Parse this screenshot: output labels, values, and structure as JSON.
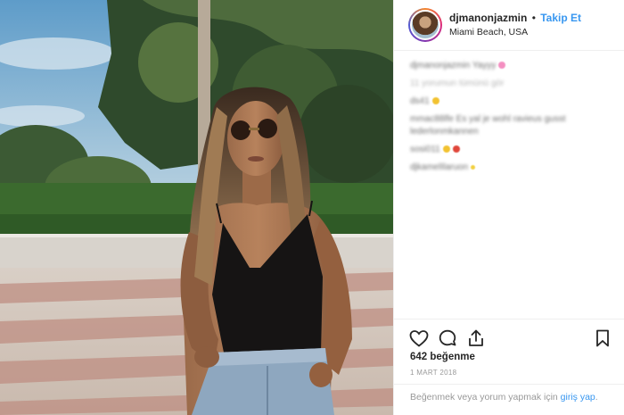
{
  "post": {
    "username": "djmanonjazmin",
    "separator": "•",
    "follow_label": "Takip Et",
    "location": "Miami Beach, USA",
    "comments": [
      {
        "text": "djmanonjazmin Yayyy",
        "style": "blur",
        "emoji_color": "#f48fc1"
      },
      {
        "text": "11 yorumun tümünü gör",
        "style": "light",
        "emoji_color": ""
      },
      {
        "text": "ds41",
        "style": "blur",
        "emoji_color": "#f2c230"
      },
      {
        "text": "mmac88lfe Es yal je wohl ravieus gusst lederlonmkannen",
        "style": "blur",
        "emoji_color": ""
      },
      {
        "text": "sosi011",
        "style": "blur",
        "emoji_color": "#e0463a"
      },
      {
        "text": "djkamelIlaruon",
        "style": "blur",
        "emoji_color": "#f2d040"
      }
    ],
    "likes_label": "642 beğenme",
    "date_label": "1 MART 2018",
    "login_prompt": "Beğenmek veya yorum yapmak için",
    "login_link": "giriş yap",
    "login_suffix": "."
  },
  "icons": {
    "like": "heart-icon",
    "comment": "comment-icon",
    "share": "share-icon",
    "save": "bookmark-icon"
  },
  "colors": {
    "accent": "#3897f0",
    "text": "#262626",
    "muted": "#999999",
    "border": "#efefef"
  }
}
